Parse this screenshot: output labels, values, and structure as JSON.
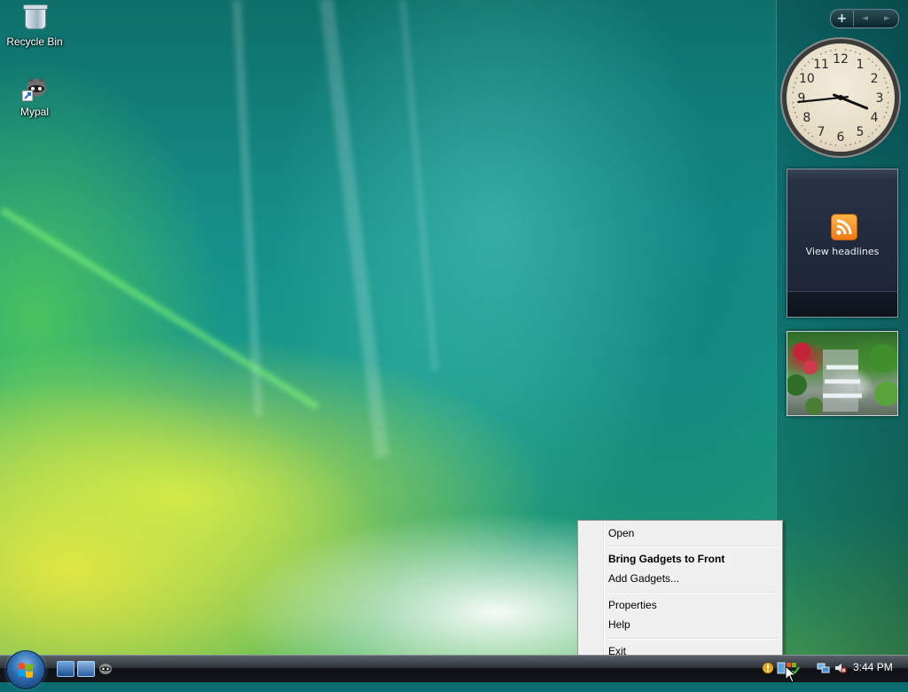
{
  "desktop": {
    "icons": [
      {
        "label": "Recycle Bin",
        "icon": "recycle-bin-icon"
      },
      {
        "label": "Mypal",
        "icon": "mypal-raccoon-icon"
      }
    ]
  },
  "sidebar": {
    "controls": {
      "add": "+",
      "prev": "◄",
      "next": "►"
    },
    "clock_gadget": {
      "numerals": [
        "12",
        "1",
        "2",
        "3",
        "4",
        "5",
        "6",
        "7",
        "8",
        "9",
        "10",
        "11"
      ],
      "time_shown": "3:44"
    },
    "feed_gadget": {
      "label": "View headlines",
      "icon": "rss-feed-icon"
    },
    "slideshow_gadget": {
      "image": "waterfall-garden-photo"
    }
  },
  "context_menu": {
    "items": [
      {
        "label": "Open"
      },
      {
        "label": "Bring Gadgets to Front",
        "bold": true
      },
      {
        "label": "Add Gadgets..."
      },
      {
        "label": "Properties"
      },
      {
        "label": "Help"
      },
      {
        "label": "Exit"
      }
    ]
  },
  "taskbar": {
    "start_button": "windows-start-orb-icon",
    "quick_launch": [
      "show-desktop-icon",
      "switch-windows-icon",
      "mypal-raccoon-icon"
    ],
    "tray": [
      "shield-alert-icon",
      "sidebar-tray-icon",
      "network-icon",
      "volume-muted-icon"
    ],
    "clock": "3:44 PM"
  },
  "colors": {
    "menu_background": "#f0f0f0",
    "taskbar": "#14181c",
    "rss_orange": "#f07a12"
  }
}
